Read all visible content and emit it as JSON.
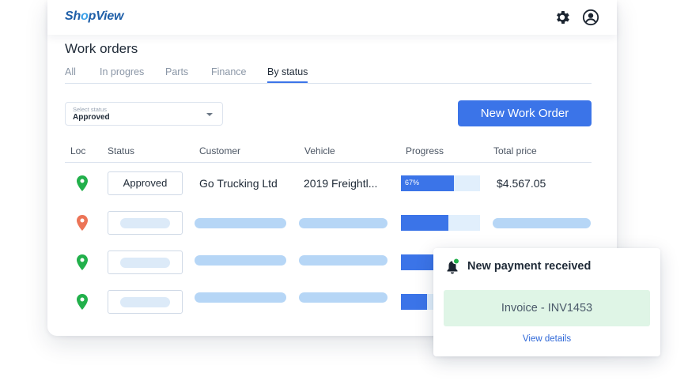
{
  "app": {
    "logo_prefix": "Sh",
    "logo_accent": "o",
    "logo_suffix": "pView"
  },
  "header": {
    "settings_icon": "gear-icon",
    "profile_icon": "user-circle-icon"
  },
  "page": {
    "title": "Work orders"
  },
  "tabs": [
    {
      "label": "All",
      "active": false
    },
    {
      "label": "In progres",
      "active": false
    },
    {
      "label": "Parts",
      "active": false
    },
    {
      "label": "Finance",
      "active": false
    },
    {
      "label": "By status",
      "active": true
    }
  ],
  "filter": {
    "label": "Select status",
    "value": "Approved"
  },
  "actions": {
    "new_work_order": "New Work Order"
  },
  "table": {
    "columns": [
      "Loc",
      "Status",
      "Customer",
      "Vehicle",
      "Progress",
      "Total price"
    ],
    "rows": [
      {
        "loc_color": "#22b04b",
        "status": "Approved",
        "customer": "Go Trucking Ltd",
        "vehicle": "2019 Freightl...",
        "progress": 0.67,
        "progress_label": "67%",
        "total": "$4.567.05"
      },
      {
        "loc_color": "#ec7457",
        "status": "",
        "customer": "",
        "vehicle": "",
        "progress": 0.6,
        "progress_label": "",
        "total": ""
      },
      {
        "loc_color": "#22b04b",
        "status": "",
        "customer": "",
        "vehicle": "",
        "progress": 0.5,
        "progress_label": "",
        "total": ""
      },
      {
        "loc_color": "#22b04b",
        "status": "",
        "customer": "",
        "vehicle": "",
        "progress": 0.33,
        "progress_label": "",
        "total": ""
      }
    ]
  },
  "notification": {
    "title": "New payment received",
    "invoice": "Invoice - INV1453",
    "link": "View details",
    "icon": "bell-icon",
    "dot_color": "#22b04b"
  },
  "colors": {
    "primary": "#3b74e8",
    "success_bg": "#dff5e6",
    "skeleton": "#b6d6f6"
  }
}
